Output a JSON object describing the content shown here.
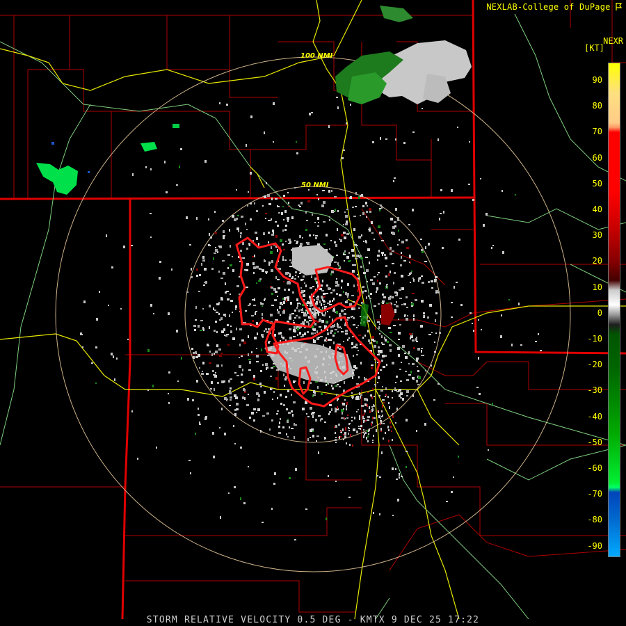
{
  "header": {
    "credit": "NEXLAB-College of DuPage",
    "credit_icon": "flag-icon",
    "product": "NEXR",
    "unit": "[KT]"
  },
  "rings": {
    "inner_label": "50 NMI",
    "outer_label": "100 NMI"
  },
  "legend": {
    "labels": [
      "90",
      "80",
      "70",
      "60",
      "50",
      "40",
      "30",
      "20",
      "10",
      "0",
      "-10",
      "-20",
      "-30",
      "-40",
      "-50",
      "-60",
      "-70",
      "-80",
      "-90"
    ],
    "colors": [
      "#ffff00",
      "#ffcc66",
      "#ff9966",
      "#ff0000",
      "#ff0000",
      "#cc0000",
      "#990000",
      "#660000",
      "#8a8a8a",
      "#ffffff",
      "#006600",
      "#008800",
      "#00aa00",
      "#00cc00",
      "#00ee44",
      "#00ff66",
      "#0055cc",
      "#0077dd",
      "#00aaff"
    ]
  },
  "footer": {
    "caption": "STORM RELATIVE VELOCITY 0.5 DEG - KMTX 9 DEC 25 17:22"
  },
  "colors": {
    "state_border": "#e00000",
    "county_border": "#cc0000",
    "highway": "#e8e800",
    "river": "#88dd88",
    "range_ring": "#f0d0a0",
    "warning_polygon": "#ff1a1a"
  }
}
